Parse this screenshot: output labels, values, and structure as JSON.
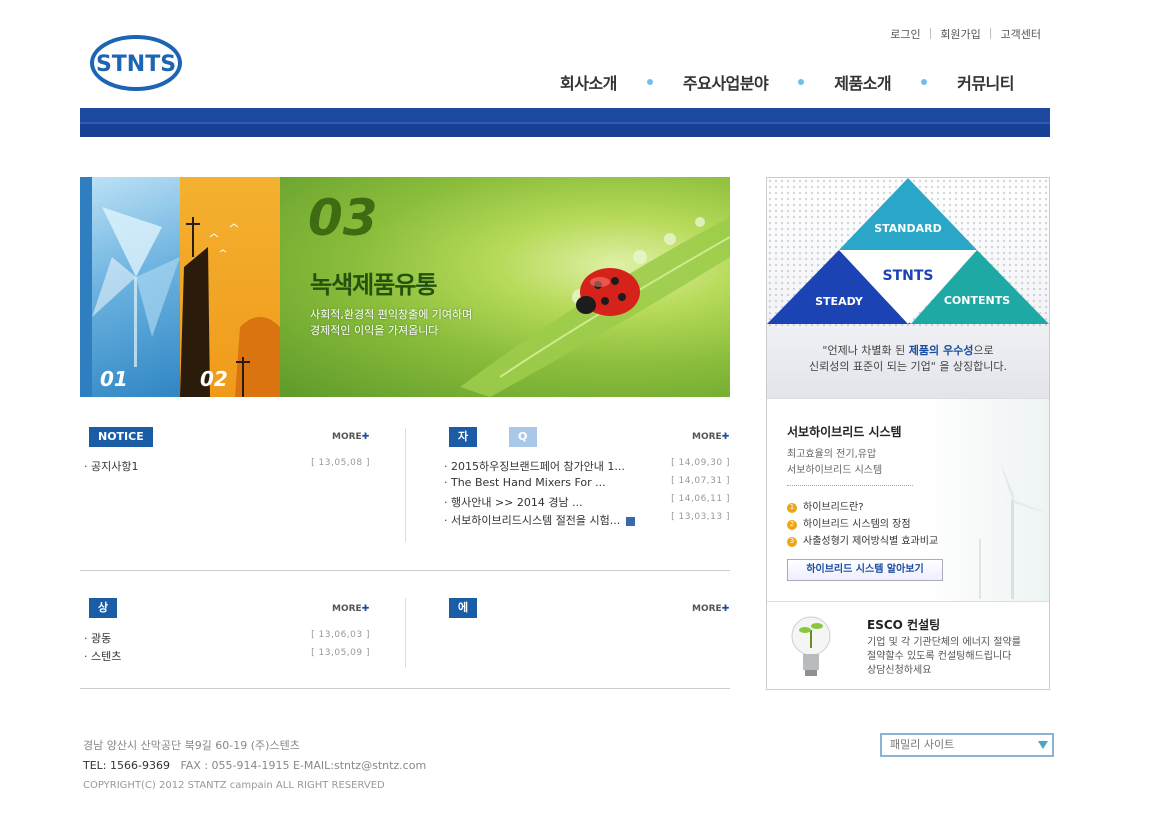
{
  "brand": {
    "logo_text": "STNTS",
    "primary_color": "#1b4aa0",
    "accent_color": "#1a5da6"
  },
  "top_links": [
    "로그인",
    "회원가입",
    "고객센터"
  ],
  "gnb": [
    "회사소개",
    "주요사업분야",
    "제품소개",
    "커뮤니티"
  ],
  "banner": {
    "tab1_label": "01",
    "tab2_label": "02",
    "number": "03",
    "title": "녹색제품유통",
    "desc_line1": "사회적,환경적 편익창출에 기여하며",
    "desc_line2": "경제적인 이익을 가져옵니다"
  },
  "promo": {
    "triangle_top": "STANDARD",
    "triangle_center": "STNTS",
    "triangle_left": "STEADY",
    "triangle_right": "CONTENTS",
    "quote_pre": "\"언제나 차별화 된 ",
    "quote_bold": "제품의 우수성",
    "quote_post": "으로",
    "quote_line2": "신뢰성의 표준이 되는 기업\" 을 상징합니다.",
    "hybrid_title": "서보하이브리드 시스템",
    "hybrid_sub1": "최고효율의 전기,유압",
    "hybrid_sub2": "서보하이브리드 시스템",
    "hybrid_items": [
      "하이브리드란?",
      "하이브리드 시스템의 장점",
      "사출성형기 제어방식별 효과비교"
    ],
    "hybrid_button": "하이브리드 시스템 알아보기",
    "esco_title": "ESCO 컨설팅",
    "esco_desc1": "기업 및 각 기관단체의 에너지 절약를",
    "esco_desc2": "절약할수 있도록 컨설팅해드립니다",
    "esco_desc3": "상담신청하세요"
  },
  "boards": {
    "more_label": "MORE",
    "notice": {
      "title": "NOTICE",
      "rows": [
        {
          "title": "· 공지사항1",
          "date": "[ 13,05,08 ]"
        }
      ]
    },
    "data": {
      "tab_active": "자료실",
      "tab_inactive": "Q & A",
      "rows": [
        {
          "title": "· 2015하우징브랜드페어 참가안내 1...",
          "date": "[ 14,09,30 ]"
        },
        {
          "title": "· The Best Hand Mixers For ...",
          "date": "[ 14,07,31 ]"
        },
        {
          "title": "· 행사안내 >> 2014 경남 ...",
          "date": "[ 14,06,11 ]"
        },
        {
          "title": "· 서보하이브리드시스템 절전을 시험...",
          "date": "[ 13,03,13 ]"
        }
      ]
    },
    "consult": {
      "title": "상담내역",
      "rows": [
        {
          "title": "· 광동",
          "date": "[ 13,06,03 ]"
        },
        {
          "title": "· 스텐츠",
          "date": "[ 13,05,09 ]"
        }
      ]
    },
    "energy": {
      "title": "에너지관리공단 공지사항"
    }
  },
  "footer": {
    "address": "경남 양산시 산막공단 북9길 60-19 (주)스텐츠",
    "tel": "TEL: 1566-9369",
    "fax_email": "FAX : 055-914-1915   E-MAIL:stntz@stntz.com",
    "copyright": "COPYRIGHT(C) 2012 STANTZ campain ALL RIGHT RESERVED",
    "family_site": "패밀리 사이트"
  }
}
